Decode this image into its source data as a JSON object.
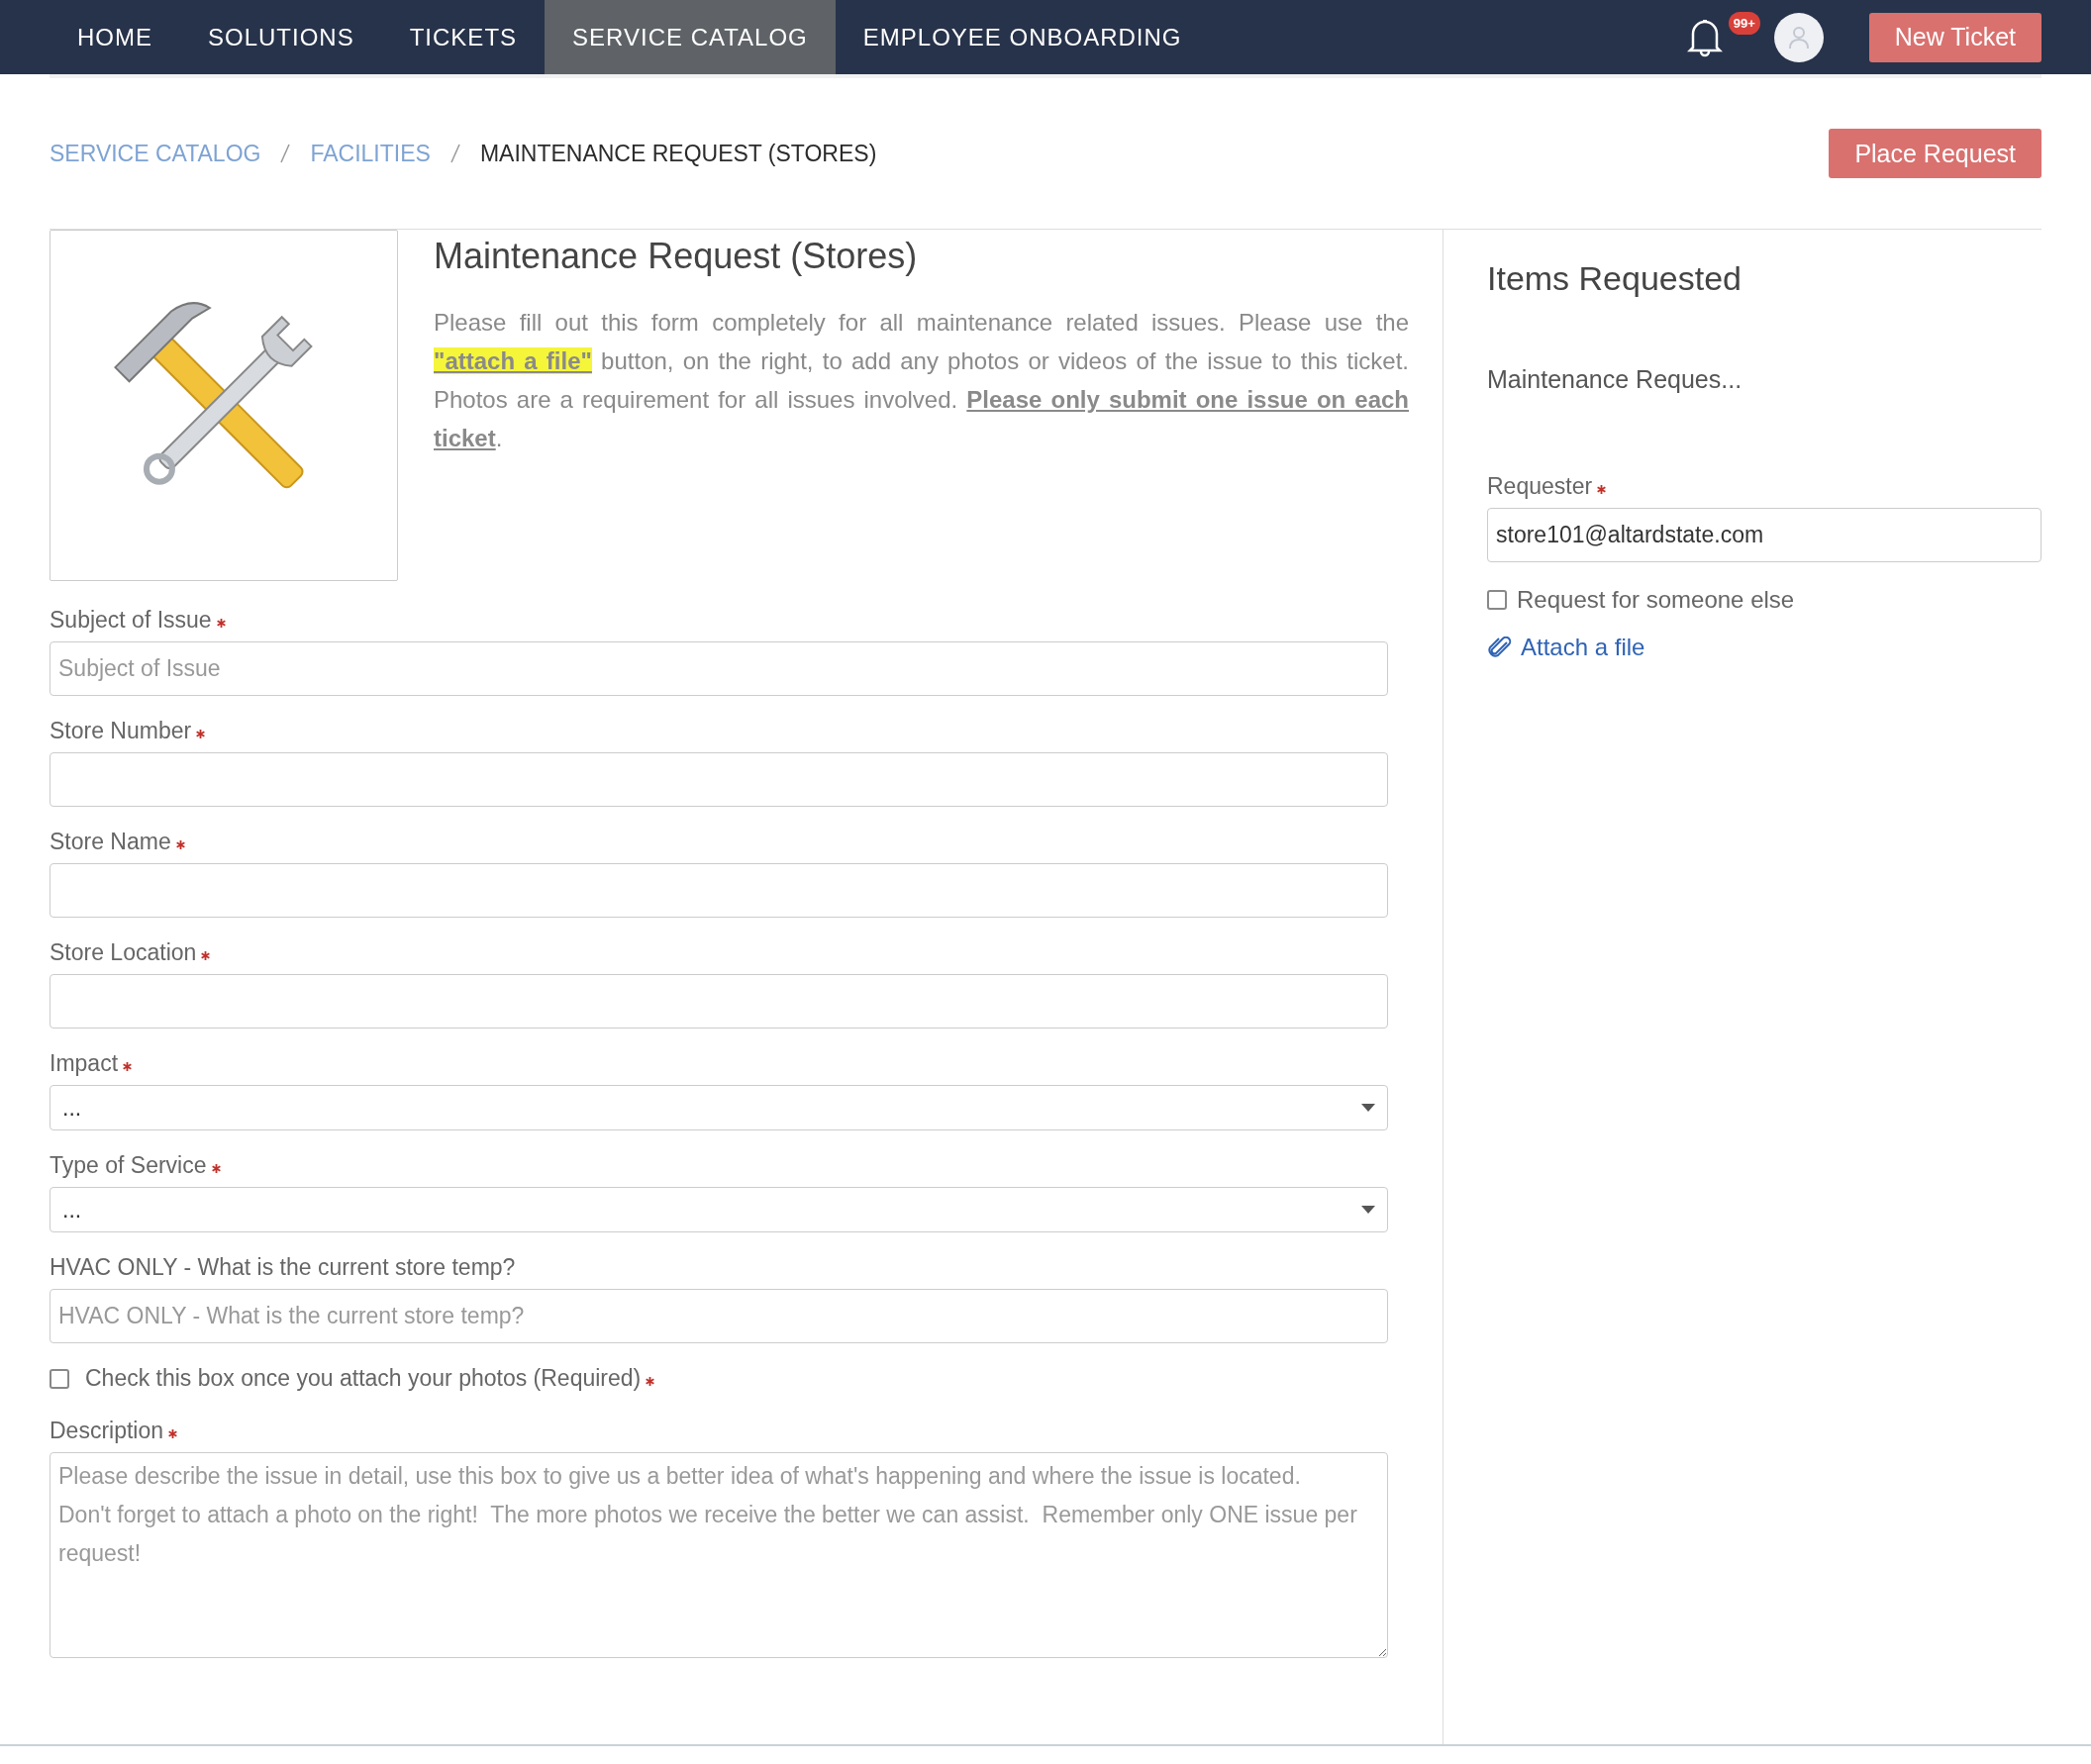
{
  "nav": {
    "tabs": [
      {
        "label": "HOME",
        "selected": false
      },
      {
        "label": "SOLUTIONS",
        "selected": false
      },
      {
        "label": "TICKETS",
        "selected": false
      },
      {
        "label": "SERVICE CATALOG",
        "selected": true
      },
      {
        "label": "EMPLOYEE ONBOARDING",
        "selected": false
      }
    ],
    "notification_badge": "99+",
    "new_ticket_button": "New Ticket"
  },
  "breadcrumb": [
    {
      "label": "SERVICE CATALOG",
      "kind": "link"
    },
    {
      "label": "FACILITIES",
      "kind": "link"
    },
    {
      "label": "MAINTENANCE REQUEST (STORES)",
      "kind": "current"
    }
  ],
  "place_request_button": "Place Request",
  "item": {
    "title": "Maintenance Request (Stores)",
    "intro": [
      {
        "kind": "text",
        "text": "Please fill out this form completely for all maintenance related issues.  Please use the "
      },
      {
        "kind": "highlight",
        "text": "\"attach a file\""
      },
      {
        "kind": "text",
        "text": " button, on the right, to add any photos or videos of the issue to this ticket.  Photos are a requirement for all issues involved.  "
      },
      {
        "kind": "emphasis",
        "text": "Please only submit one issue on each ticket"
      },
      {
        "kind": "text",
        "text": "."
      }
    ]
  },
  "form": [
    {
      "kind": "text",
      "label": "Subject of Issue",
      "required": true,
      "placeholder": "Subject of Issue"
    },
    {
      "kind": "text",
      "label": "Store Number",
      "required": true
    },
    {
      "kind": "text",
      "label": "Store Name",
      "required": true
    },
    {
      "kind": "text",
      "label": "Store Location",
      "required": true
    },
    {
      "kind": "select",
      "label": "Impact",
      "required": true,
      "value": "..."
    },
    {
      "kind": "select",
      "label": "Type of Service",
      "required": true,
      "value": "..."
    },
    {
      "kind": "text",
      "label": "HVAC ONLY - What is the current store temp?",
      "required": false,
      "placeholder": "HVAC ONLY - What is the current store temp?"
    },
    {
      "kind": "checkbox",
      "label": "Check this box once you attach your photos (Required)",
      "required": true,
      "checked": false
    },
    {
      "kind": "textarea",
      "label": "Description",
      "required": true,
      "placeholder": "Please describe the issue in detail, use this box to give us a better idea of what's happening and where the issue is located.  Don't forget to attach a photo on the right!  The more photos we receive the better we can assist.  Remember only ONE issue per request!"
    }
  ],
  "side": {
    "title": "Items Requested",
    "item": "Maintenance Reques...",
    "requester_label": "Requester",
    "requester_value": "store101@altardstate.com",
    "someone_else": {
      "label": "Request for someone else",
      "checked": false
    },
    "attach_link": "Attach a file"
  }
}
